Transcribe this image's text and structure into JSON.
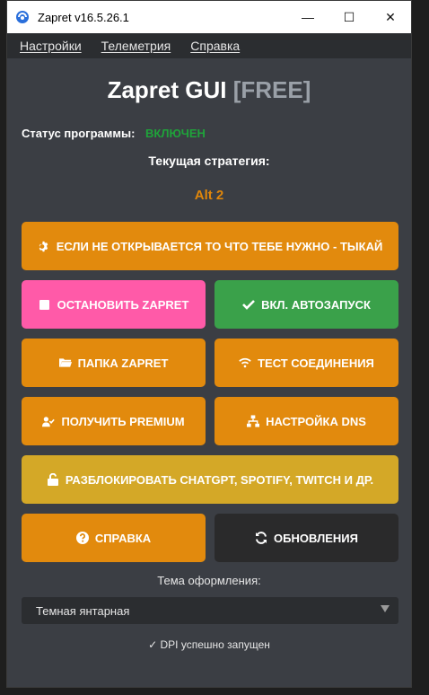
{
  "window": {
    "title": "Zapret v16.5.26.1",
    "minimize_glyph": "—",
    "maximize_glyph": "☐",
    "close_glyph": "✕"
  },
  "menu": {
    "items": [
      "Настройки",
      "Телеметрия",
      "Справка"
    ]
  },
  "header": {
    "title": "Zapret GUI",
    "tag": "[FREE]"
  },
  "status": {
    "label": "Статус программы:",
    "value": "ВКЛЮЧЕН",
    "value_color": "#1fa33a"
  },
  "strategy": {
    "label": "Текущая стратегия:",
    "value": "Alt 2",
    "value_color": "#e0860a"
  },
  "buttons": {
    "help_me": {
      "label": "ЕСЛИ НЕ ОТКРЫВАЕТСЯ ТО ЧТО ТЕБЕ НУЖНО - ТЫКАЙ",
      "icon": "gear-icon"
    },
    "stop": {
      "label": "ОСТАНОВИТЬ ZAPRET",
      "icon": "stop-icon"
    },
    "autostart": {
      "label": "ВКЛ. АВТОЗАПУСК",
      "icon": "check-icon"
    },
    "folder": {
      "label": "ПАПКА ZAPRET",
      "icon": "folder-icon"
    },
    "test": {
      "label": "ТЕСТ СОЕДИНЕНИЯ",
      "icon": "wifi-icon"
    },
    "premium": {
      "label": "ПОЛУЧИТЬ PREMIUM",
      "icon": "user-check-icon"
    },
    "dns": {
      "label": "НАСТРОЙКА DNS",
      "icon": "network-icon"
    },
    "unblock": {
      "label": "РАЗБЛОКИРОВАТЬ CHATGPT, SPOTIFY, TWITCH И ДР.",
      "icon": "unlock-icon"
    },
    "help": {
      "label": "СПРАВКА",
      "icon": "question-icon"
    },
    "updates": {
      "label": "ОБНОВЛЕНИЯ",
      "icon": "refresh-icon"
    }
  },
  "colors": {
    "orange": "#e28a0d",
    "pink": "#ff5aa8",
    "green": "#3aa14a",
    "yellow": "#d4a827",
    "dark": "#2a2a2b",
    "background": "#3b3e44"
  },
  "theme": {
    "label": "Тема оформления:",
    "selected": "Темная янтарная"
  },
  "footer": {
    "status": "✓ DPI успешно запущен"
  }
}
